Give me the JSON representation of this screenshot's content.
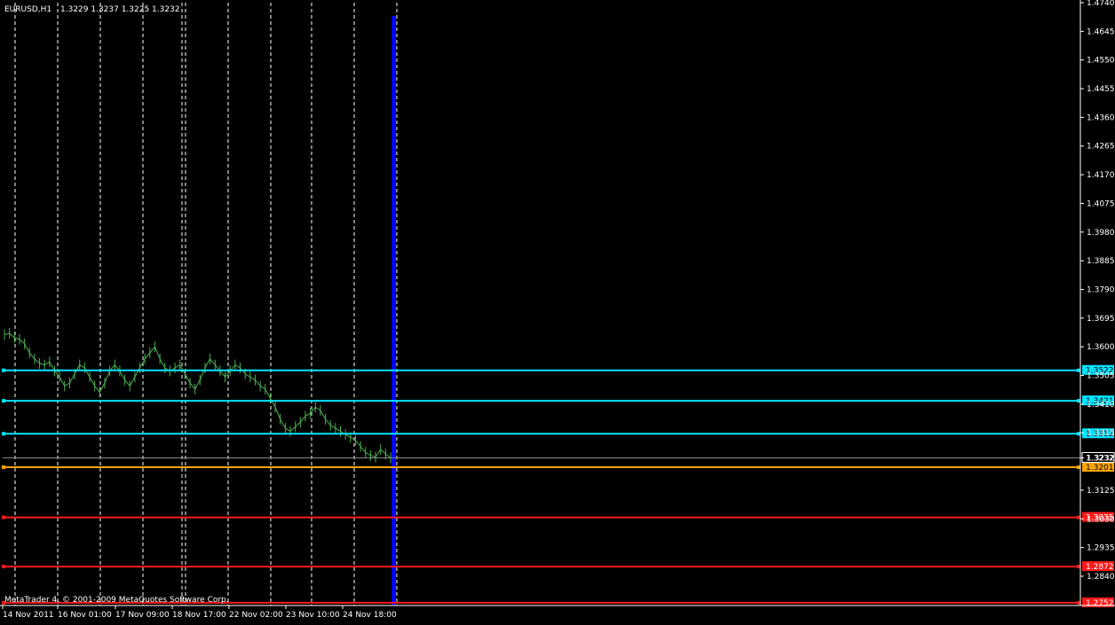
{
  "header": {
    "symbol": "EURUSD,H1",
    "ohlc": "1.3229 1.3237 1.3225 1.3232"
  },
  "footer": {
    "copyright": "MetaTrader 4, © 2001-2009 MetaQuotes Software Corp."
  },
  "colors": {
    "background": "#000000",
    "axis": "#ffffff",
    "grid": "#ffffff",
    "candle": "#4caf50",
    "support_line": "#00e5ff",
    "orange_line": "#ffa500",
    "red_line": "#ff1a1a",
    "separator": "#0000ff"
  },
  "chart_data": {
    "type": "line",
    "symbol": "EURUSD",
    "timeframe": "H1",
    "ylim": [
      1.2743,
      1.474
    ],
    "y_ticks": [
      "1.4740",
      "1.4645",
      "1.4550",
      "1.4455",
      "1.4360",
      "1.4265",
      "1.4170",
      "1.4075",
      "1.3980",
      "1.3885",
      "1.3790",
      "1.3695",
      "1.3600",
      "1.3505",
      "1.3410",
      "1.3315",
      "1.3232",
      "1.3125",
      "1.3030",
      "1.2935",
      "1.2840"
    ],
    "x_tick_labels": [
      "14 Nov 2011",
      "16 Nov 01:00",
      "17 Nov 09:00",
      "18 Nov 17:00",
      "22 Nov 02:00",
      "23 Nov 10:00",
      "24 Nov 18:00"
    ],
    "grid": "dashed vertical",
    "current_price": "1.3232",
    "horizontal_levels": [
      {
        "value": 1.3522,
        "label": "1.3522",
        "color": "#00e5ff"
      },
      {
        "value": 1.3421,
        "label": "1.3421",
        "color": "#00e5ff"
      },
      {
        "value": 1.3312,
        "label": "1.3312",
        "color": "#00e5ff"
      },
      {
        "value": 1.3201,
        "label": "1.3201",
        "color": "#ffa500"
      },
      {
        "value": 1.3035,
        "label": "1.3035",
        "color": "#ff1a1a"
      },
      {
        "value": 1.2872,
        "label": "1.2872",
        "color": "#ff1a1a"
      },
      {
        "value": 1.2752,
        "label": "1.2752",
        "color": "#ff1a1a"
      }
    ],
    "price_series": [
      1.364,
      1.3645,
      1.363,
      1.3625,
      1.361,
      1.358,
      1.356,
      1.3545,
      1.354,
      1.355,
      1.352,
      1.35,
      1.347,
      1.348,
      1.351,
      1.354,
      1.353,
      1.35,
      1.347,
      1.345,
      1.348,
      1.352,
      1.354,
      1.352,
      1.349,
      1.347,
      1.35,
      1.353,
      1.356,
      1.358,
      1.36,
      1.356,
      1.353,
      1.352,
      1.353,
      1.354,
      1.351,
      1.348,
      1.346,
      1.349,
      1.353,
      1.356,
      1.354,
      1.352,
      1.35,
      1.352,
      1.354,
      1.353,
      1.351,
      1.35,
      1.349,
      1.347,
      1.346,
      1.343,
      1.34,
      1.336,
      1.333,
      1.332,
      1.3335,
      1.335,
      1.337,
      1.338,
      1.34,
      1.339,
      1.336,
      1.334,
      1.333,
      1.332,
      1.331,
      1.33,
      1.329,
      1.327,
      1.325,
      1.324,
      1.3235,
      1.326,
      1.3245,
      1.3232
    ]
  }
}
